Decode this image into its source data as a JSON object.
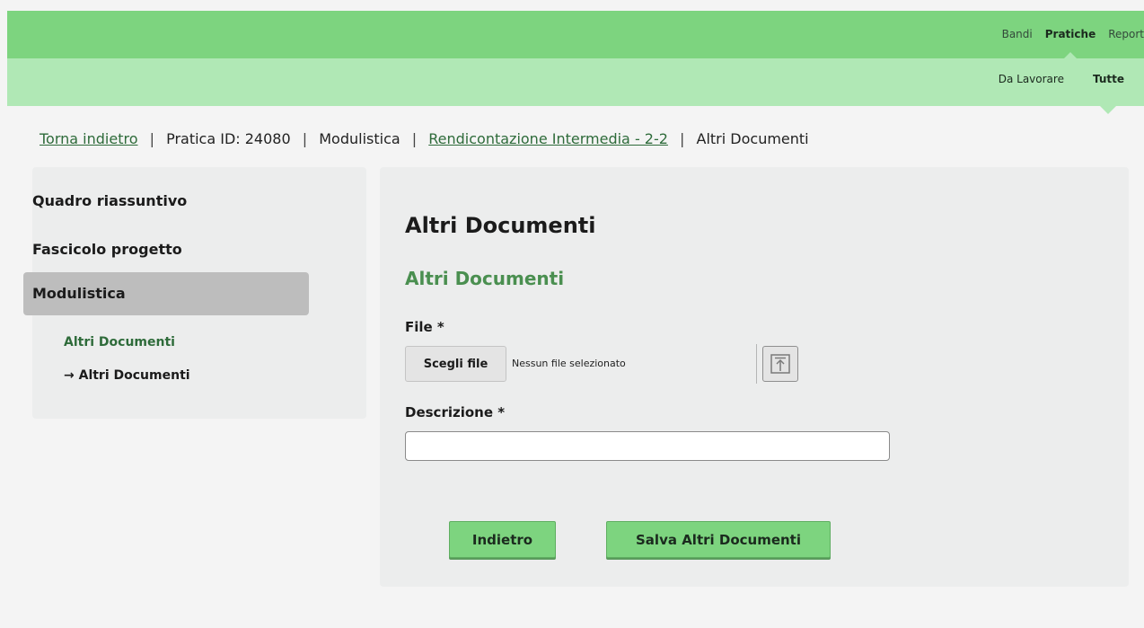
{
  "topnav": {
    "items": [
      "Bandi",
      "Pratiche",
      "Report"
    ],
    "active": "Pratiche"
  },
  "subnav": {
    "items": [
      "Da Lavorare",
      "Tutte"
    ],
    "active": "Tutte"
  },
  "breadcrumb": {
    "back": "Torna indietro",
    "pratica": "Pratica ID: 24080",
    "modulistica": "Modulistica",
    "rendicontazione": "Rendicontazione Intermedia - 2-2",
    "current": "Altri Documenti",
    "separator": "|"
  },
  "sidebar": {
    "items": [
      "Quadro riassuntivo",
      "Fascicolo progetto",
      "Modulistica"
    ],
    "active": "Modulistica",
    "sub_title": "Altri Documenti",
    "sub_items": [
      "Altri Documenti"
    ],
    "sub_item_marker": "→"
  },
  "main": {
    "title": "Altri Documenti",
    "subtitle": "Altri Documenti",
    "file_label": "File *",
    "file_button": "Scegli file",
    "file_status": "Nessun file selezionato",
    "upload_icon": "upload-icon",
    "description_label": "Descrizione *",
    "description_value": "",
    "description_placeholder": "",
    "back_button": "Indietro",
    "save_button": "Salva Altri Documenti"
  },
  "colors": {
    "topbar": "#7dd47f",
    "subbar": "#b0e8b5",
    "accent_green": "#4a8f50",
    "button_green": "#7dd47f",
    "link_green": "#2e6b3a"
  }
}
